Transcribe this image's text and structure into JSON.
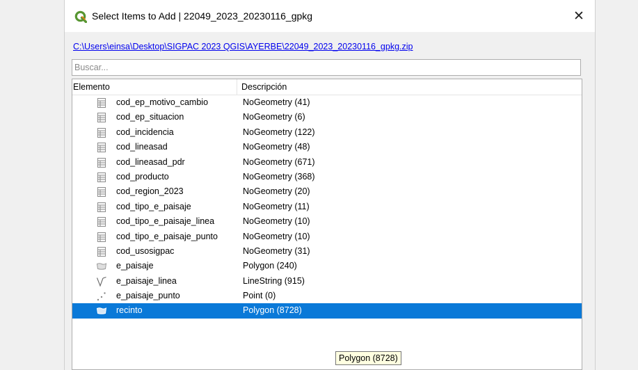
{
  "window": {
    "title": "Select Items to Add | 22049_2023_20230116_gpkg",
    "close_glyph": "✕"
  },
  "file_path": "C:\\Users\\einsa\\Desktop\\SIGPAC 2023 QGIS\\AYERBE\\22049_2023_20230116_gpkg.zip",
  "search": {
    "placeholder": "Buscar...",
    "value": ""
  },
  "tree": {
    "columns": {
      "element": "Elemento",
      "description": "Descripción"
    },
    "rows": [
      {
        "name": "cod_ep_motivo_cambio",
        "desc": "NoGeometry (41)",
        "icon": "table-icon"
      },
      {
        "name": "cod_ep_situacion",
        "desc": "NoGeometry (6)",
        "icon": "table-icon"
      },
      {
        "name": "cod_incidencia",
        "desc": "NoGeometry (122)",
        "icon": "table-icon"
      },
      {
        "name": "cod_lineasad",
        "desc": "NoGeometry (48)",
        "icon": "table-icon"
      },
      {
        "name": "cod_lineasad_pdr",
        "desc": "NoGeometry (671)",
        "icon": "table-icon"
      },
      {
        "name": "cod_producto",
        "desc": "NoGeometry (368)",
        "icon": "table-icon"
      },
      {
        "name": "cod_region_2023",
        "desc": "NoGeometry (20)",
        "icon": "table-icon"
      },
      {
        "name": "cod_tipo_e_paisaje",
        "desc": "NoGeometry (11)",
        "icon": "table-icon"
      },
      {
        "name": "cod_tipo_e_paisaje_linea",
        "desc": "NoGeometry (10)",
        "icon": "table-icon"
      },
      {
        "name": "cod_tipo_e_paisaje_punto",
        "desc": "NoGeometry (10)",
        "icon": "table-icon"
      },
      {
        "name": "cod_usosigpac",
        "desc": "NoGeometry (31)",
        "icon": "table-icon"
      },
      {
        "name": "e_paisaje",
        "desc": "Polygon (240)",
        "icon": "polygon-layer-icon"
      },
      {
        "name": "e_paisaje_linea",
        "desc": "LineString (915)",
        "icon": "line-layer-icon"
      },
      {
        "name": "e_paisaje_punto",
        "desc": "Point (0)",
        "icon": "point-layer-icon"
      },
      {
        "name": "recinto",
        "desc": "Polygon (8728)",
        "icon": "polygon-layer-icon",
        "selected": true
      }
    ]
  },
  "tooltip": {
    "text": "Polygon (8728)"
  },
  "colors": {
    "selection": "#0a79d8",
    "link": "#0000ee",
    "tooltip_bg": "#ffffe1",
    "qgis_green": "#589632",
    "qgis_yellow": "#ee7913"
  }
}
